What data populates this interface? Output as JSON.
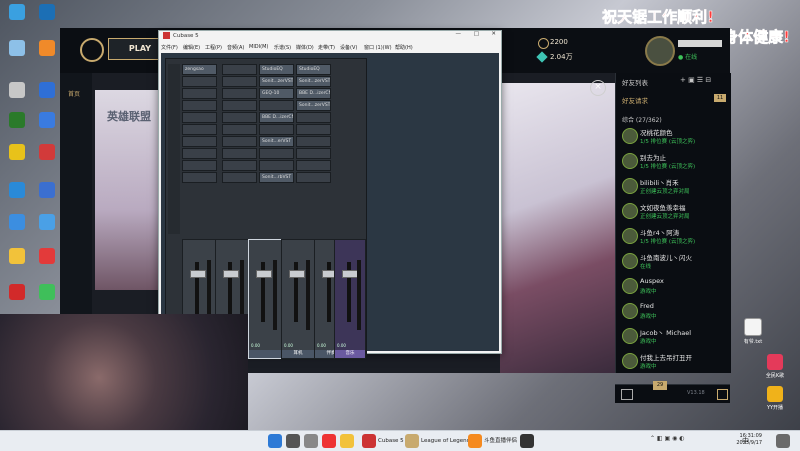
{
  "overlay": {
    "line1": "祝天锯工作顺利!",
    "line2": "祝直播间哥哥姐姐身体健康!"
  },
  "desktop": {
    "icons": [
      "",
      "",
      "",
      "",
      "",
      "",
      "",
      "",
      "",
      "",
      "",
      "",
      "",
      "",
      "",
      "",
      "",
      "",
      "",
      ""
    ],
    "right_icons": [
      "有爷.txt",
      "全民K歌",
      "YY开播"
    ]
  },
  "lol": {
    "play": "PLAY",
    "currency_be": "2200",
    "currency_rp": "2.04万",
    "home_tab": "首页",
    "banner_title": "英雄联盟",
    "friends": {
      "title": "好友列表",
      "requests": "好友请求",
      "requests_count": "11",
      "group": "综合 (27/362)",
      "list": [
        {
          "name": "况桃花颜色",
          "status": "1/5 排位赛 (云顶之弈)"
        },
        {
          "name": "别去为止",
          "status": "1/5 排位赛 (云顶之弈)"
        },
        {
          "name": "bilibili丶肖禾",
          "status": "正创建云顶之弈对局"
        },
        {
          "name": "文如夜鱼羡幸福",
          "status": "正创建云顶之弈对局"
        },
        {
          "name": "斗鱼r4丶阿涛",
          "status": "1/5 排位赛 (云顶之弈)"
        },
        {
          "name": "斗鱼南波儿丶闪火",
          "status": "在线"
        },
        {
          "name": "Auspex",
          "status": "游戏中"
        },
        {
          "name": "Fred",
          "status": "游戏中"
        },
        {
          "name": "Jacob丶 Michael",
          "status": "游戏中"
        },
        {
          "name": "付我上去吊打丑开",
          "status": "游戏中"
        }
      ],
      "footer_count": "29",
      "version": "V13.18"
    }
  },
  "cubase": {
    "title": "Cubase 5",
    "menu": [
      "文件(F)",
      "编辑(E)",
      "工程(P)",
      "音频(A)",
      "MIDI(M)",
      "乐谱(S)",
      "媒体(D)",
      "走带(T)",
      "设备(V)",
      "窗口 (1)(W)",
      "帮助(H)"
    ],
    "slots": {
      "col1": [
        "zengsao",
        "",
        "",
        "",
        "",
        "",
        "",
        "",
        "",
        ""
      ],
      "col2": [
        "StudioEQ",
        "Sonit...zerVST",
        "GEQ-10",
        "",
        "BBE D...izerCN",
        "",
        "Sonit...erVST",
        "",
        "",
        "Sonit...rbVST"
      ],
      "col3": [
        "StudioEQ",
        "Sonit...zerVST",
        "BBE D...izerCN",
        "Sonit...zerVST",
        "",
        "",
        "",
        "",
        "",
        ""
      ]
    },
    "channels": [
      {
        "name": "",
        "value": "0.00"
      },
      {
        "name": "",
        "value": "0.00"
      },
      {
        "name": "",
        "value": "0.00"
      },
      {
        "name": "耳机",
        "value": "0.00"
      },
      {
        "name": "伴奏",
        "value": "0.00"
      },
      {
        "name": "音乐",
        "value": "0.00"
      }
    ]
  },
  "taskbar": {
    "apps": [
      "Cubase 5",
      "League of Legends",
      "斗鱼直播伴侣"
    ],
    "time": "16:31:09",
    "date": "2023/9/17",
    "ime": "中"
  }
}
